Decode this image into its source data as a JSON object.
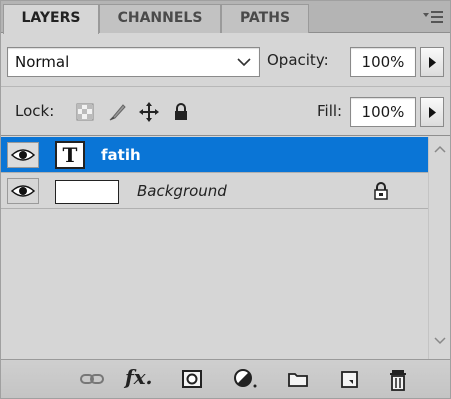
{
  "tabs": [
    {
      "label": "LAYERS",
      "active": true
    },
    {
      "label": "CHANNELS",
      "active": false
    },
    {
      "label": "PATHS",
      "active": false
    }
  ],
  "panel_menu_icon": "panel-menu-icon",
  "blend": {
    "mode": "Normal",
    "opacity_label": "Opacity:",
    "opacity_value": "100%"
  },
  "lock": {
    "label": "Lock:",
    "icons": [
      "lock-transparent-pixels-icon",
      "lock-image-pixels-icon",
      "lock-position-icon",
      "lock-all-icon"
    ],
    "fill_label": "Fill:",
    "fill_value": "100%"
  },
  "layers": [
    {
      "name": "fatih",
      "type": "text",
      "thumb_glyph": "T",
      "visible": true,
      "selected": true,
      "locked": false
    },
    {
      "name": "Background",
      "type": "image",
      "visible": true,
      "selected": false,
      "locked": true
    }
  ],
  "bottom_toolbar": {
    "fx_label": "fx",
    "icons": [
      "link-layers-icon",
      "layer-style-fx-icon",
      "add-mask-icon",
      "adjustment-layer-icon",
      "new-group-icon",
      "new-layer-icon",
      "delete-layer-icon"
    ]
  },
  "colors": {
    "panel_bg": "#d6d6d6",
    "selection": "#0a75d6",
    "tab_strip": "#b4b4b4"
  }
}
